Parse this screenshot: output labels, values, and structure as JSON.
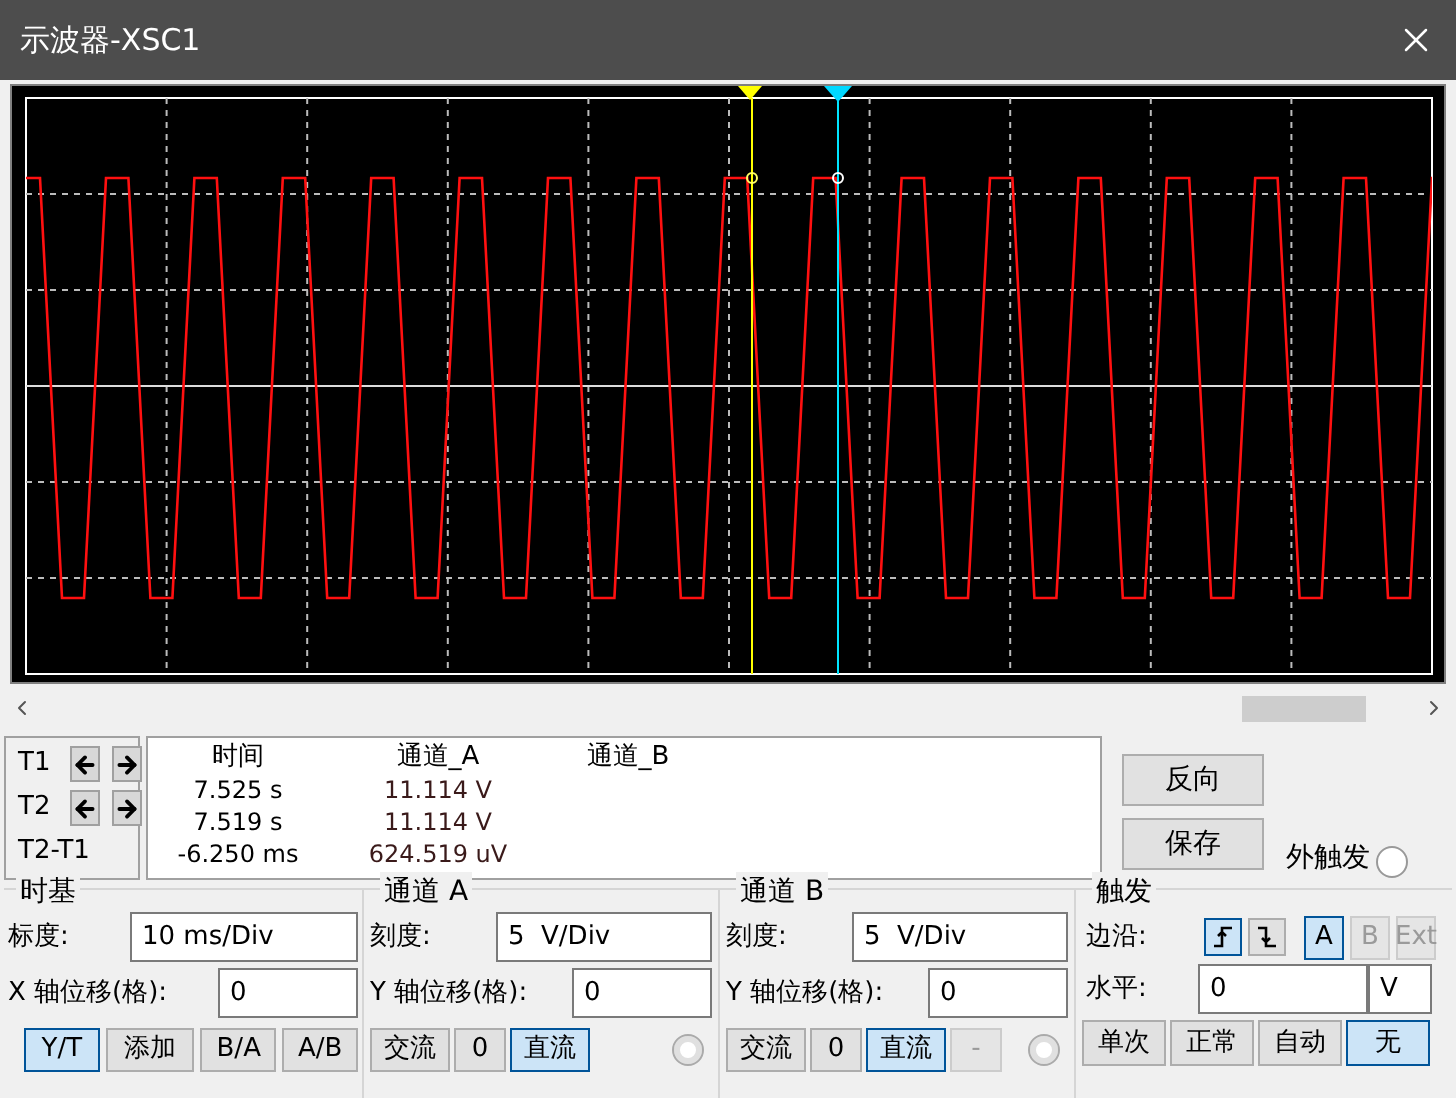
{
  "window": {
    "title": "示波器-XSC1"
  },
  "cursors": [
    {
      "label": "T1",
      "kind": "arrows"
    },
    {
      "label": "T2",
      "kind": "arrows"
    },
    {
      "label": "T2-T1",
      "kind": "plain"
    }
  ],
  "readout": {
    "columns": [
      "时间",
      "通道_A",
      "通道_B"
    ],
    "rows": [
      [
        "7.525 s",
        "11.114 V"
      ],
      [
        "7.519 s",
        "11.114 V"
      ],
      [
        "-6.250 ms",
        "624.519 uV"
      ]
    ]
  },
  "actions": [
    "反向",
    "保存"
  ],
  "ext_trigger": {
    "label": "外触发",
    "checked": false
  },
  "timebase": {
    "title": "时基",
    "scale_label": "标度:",
    "scale_value": "10 ms/Div",
    "pos_label": "X 轴位移(格):",
    "pos_value": "0",
    "modes": [
      {
        "label": "Y/T",
        "selected": true
      },
      {
        "label": "添加",
        "selected": false
      },
      {
        "label": "B/A",
        "selected": false
      },
      {
        "label": "A/B",
        "selected": false
      }
    ]
  },
  "channels": [
    {
      "title": "通道 A",
      "checked": false,
      "scale_label": "刻度:",
      "scale_value": "5  V/Div",
      "pos_label": "Y 轴位移(格):",
      "pos_value": "0",
      "coupling": [
        {
          "label": "交流",
          "selected": false,
          "disabled": false
        },
        {
          "label": "0",
          "selected": false,
          "disabled": false
        },
        {
          "label": "直流",
          "selected": true,
          "disabled": false
        }
      ]
    },
    {
      "title": "通道 B",
      "checked": false,
      "scale_label": "刻度:",
      "scale_value": "5  V/Div",
      "pos_label": "Y 轴位移(格):",
      "pos_value": "0",
      "coupling": [
        {
          "label": "交流",
          "selected": false,
          "disabled": false
        },
        {
          "label": "0",
          "selected": false,
          "disabled": false
        },
        {
          "label": "直流",
          "selected": true,
          "disabled": false
        },
        {
          "label": "-",
          "selected": false,
          "disabled": true
        }
      ]
    }
  ],
  "trigger": {
    "title": "触发",
    "edge_label": "边沿:",
    "edges": [
      {
        "kind": "rising",
        "selected": true
      },
      {
        "kind": "falling",
        "selected": false
      }
    ],
    "sources": [
      {
        "label": "A",
        "selected": true,
        "disabled": false
      },
      {
        "label": "B",
        "selected": false,
        "disabled": true
      },
      {
        "label": "Ext",
        "selected": false,
        "disabled": true
      }
    ],
    "level_label": "水平:",
    "level_value": "0",
    "level_unit": "V",
    "modes": [
      {
        "label": "单次",
        "selected": false
      },
      {
        "label": "正常",
        "selected": false
      },
      {
        "label": "自动",
        "selected": false
      },
      {
        "label": "无",
        "selected": true
      }
    ]
  }
}
